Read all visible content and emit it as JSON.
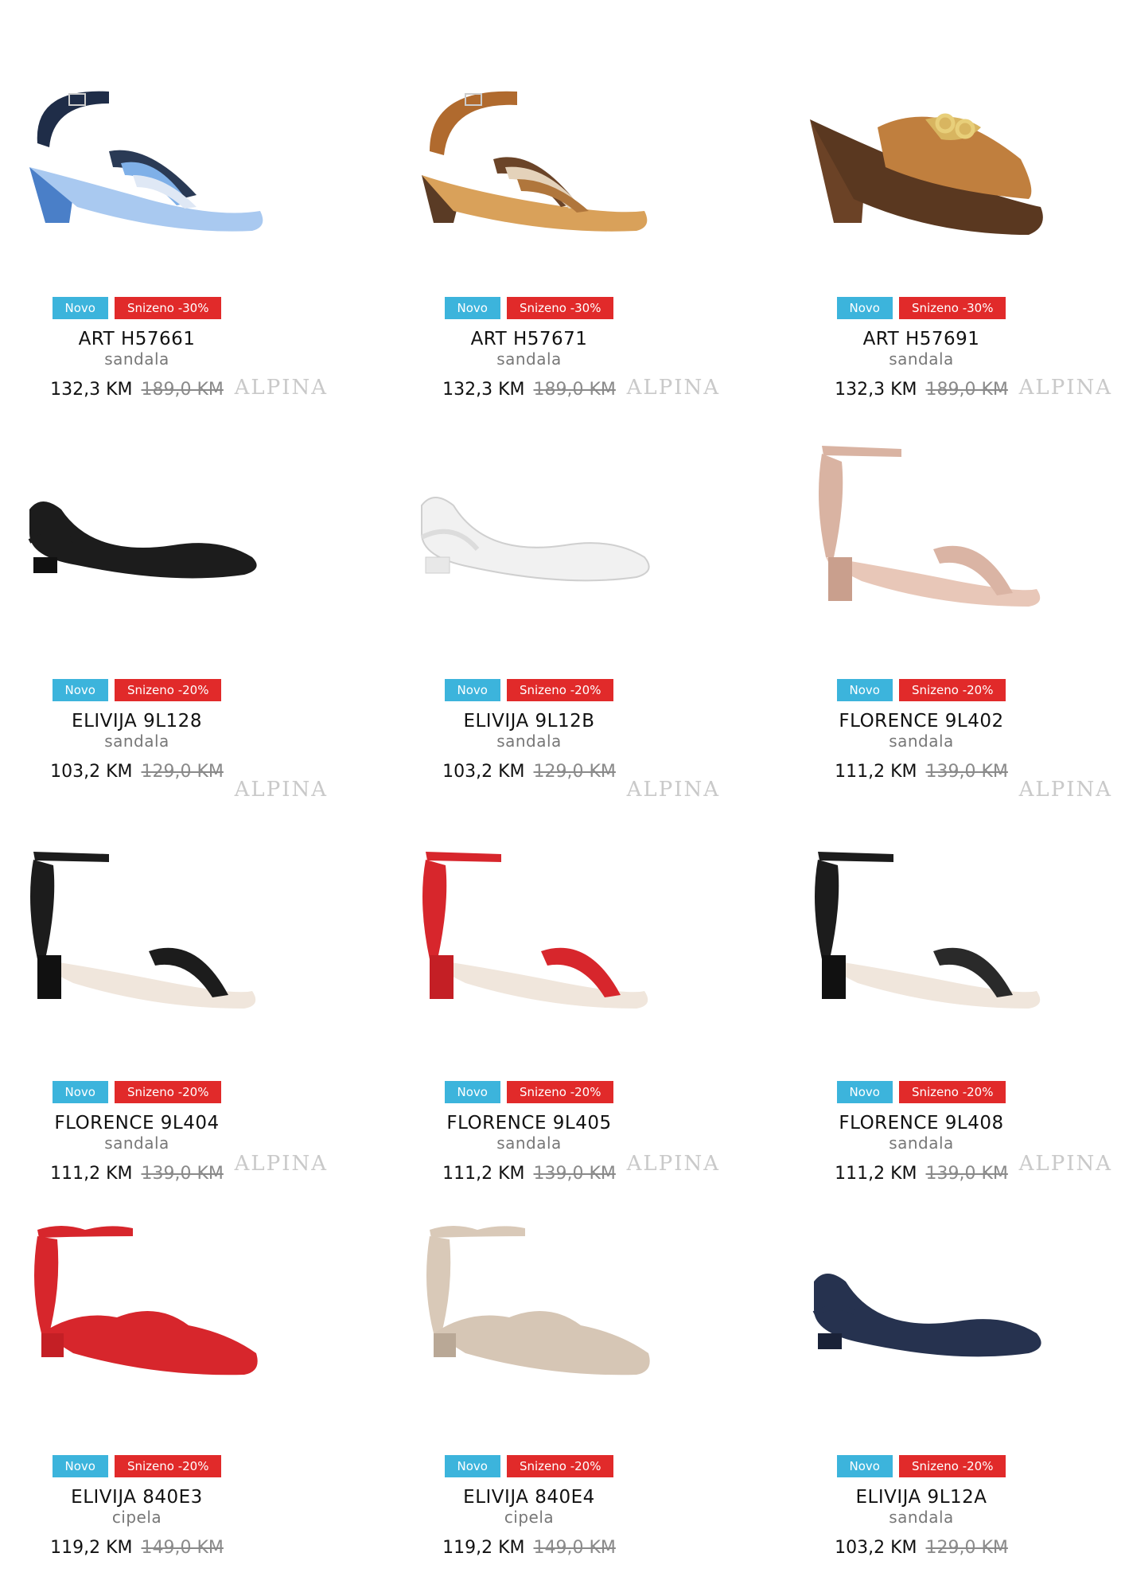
{
  "brand_watermark": "ALPINA",
  "colors": {
    "badge_new": "#3cb4dc",
    "badge_sale": "#e12a2a"
  },
  "products": [
    {
      "badge_new": "Novo",
      "badge_sale": "Snizeno -30%",
      "name": "ART H57661",
      "type": "sandala",
      "price": "132,3 KM",
      "old_price": "189,0 KM",
      "color": "blue"
    },
    {
      "badge_new": "Novo",
      "badge_sale": "Snizeno -30%",
      "name": "ART H57671",
      "type": "sandala",
      "price": "132,3 KM",
      "old_price": "189,0 KM",
      "color": "tan"
    },
    {
      "badge_new": "Novo",
      "badge_sale": "Snizeno -30%",
      "name": "ART H57691",
      "type": "sandala",
      "price": "132,3 KM",
      "old_price": "189,0 KM",
      "color": "cognac"
    },
    {
      "badge_new": "Novo",
      "badge_sale": "Snizeno -20%",
      "name": "ELIVIJA 9L128",
      "type": "sandala",
      "price": "103,2 KM",
      "old_price": "129,0 KM",
      "color": "black"
    },
    {
      "badge_new": "Novo",
      "badge_sale": "Snizeno -20%",
      "name": "ELIVIJA 9L12B",
      "type": "sandala",
      "price": "103,2 KM",
      "old_price": "129,0 KM",
      "color": "white"
    },
    {
      "badge_new": "Novo",
      "badge_sale": "Snizeno -20%",
      "name": "FLORENCE 9L402",
      "type": "sandala",
      "price": "111,2 KM",
      "old_price": "139,0 KM",
      "color": "nude"
    },
    {
      "badge_new": "Novo",
      "badge_sale": "Snizeno -20%",
      "name": "FLORENCE 9L404",
      "type": "sandala",
      "price": "111,2 KM",
      "old_price": "139,0 KM",
      "color": "black"
    },
    {
      "badge_new": "Novo",
      "badge_sale": "Snizeno -20%",
      "name": "FLORENCE 9L405",
      "type": "sandala",
      "price": "111,2 KM",
      "old_price": "139,0 KM",
      "color": "red"
    },
    {
      "badge_new": "Novo",
      "badge_sale": "Snizeno -20%",
      "name": "FLORENCE 9L408",
      "type": "sandala",
      "price": "111,2 KM",
      "old_price": "139,0 KM",
      "color": "black"
    },
    {
      "badge_new": "Novo",
      "badge_sale": "Snizeno -20%",
      "name": "ELIVIJA 840E3",
      "type": "cipela",
      "price": "119,2 KM",
      "old_price": "149,0 KM",
      "color": "red"
    },
    {
      "badge_new": "Novo",
      "badge_sale": "Snizeno -20%",
      "name": "ELIVIJA 840E4",
      "type": "cipela",
      "price": "119,2 KM",
      "old_price": "149,0 KM",
      "color": "beige"
    },
    {
      "badge_new": "Novo",
      "badge_sale": "Snizeno -20%",
      "name": "ELIVIJA 9L12A",
      "type": "sandala",
      "price": "103,2 KM",
      "old_price": "129,0 KM",
      "color": "navy"
    }
  ]
}
